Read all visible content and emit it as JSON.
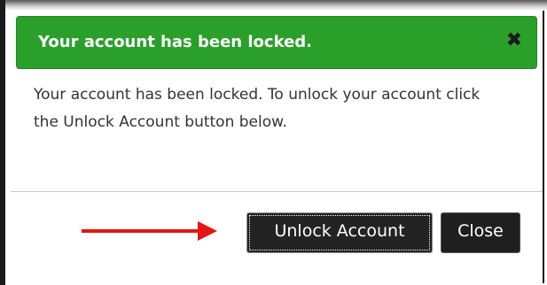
{
  "dialog": {
    "title": "Your account has been locked.",
    "close_icon": "close-icon",
    "message": "Your account has been locked. To unlock your account click the Unlock Account button below.",
    "buttons": {
      "unlock_label": "Unlock Account",
      "close_label": "Close"
    }
  },
  "annotation": {
    "arrow_icon": "arrow-right-icon",
    "arrow_color": "#e61414"
  },
  "colors": {
    "header_bg": "#2aa02a",
    "button_bg": "#1f1f1f"
  }
}
